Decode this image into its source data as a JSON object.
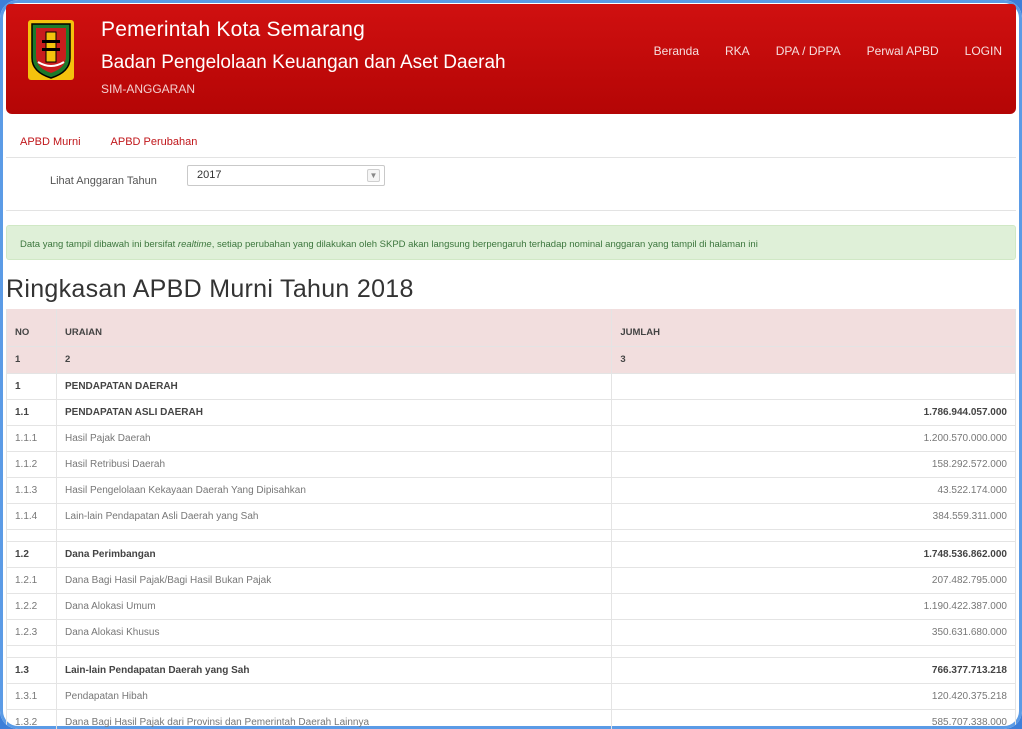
{
  "header": {
    "title": "Pemerintah Kota Semarang",
    "subtitle": "Badan Pengelolaan Keuangan dan Aset Daerah",
    "app": "SIM-ANGGARAN",
    "nav": [
      "Beranda",
      "RKA",
      "DPA / DPPA",
      "Perwal APBD",
      "LOGIN"
    ]
  },
  "subnav": [
    "APBD Murni",
    "APBD Perubahan"
  ],
  "year_filter": {
    "label": "Lihat Anggaran Tahun",
    "value": "2017"
  },
  "alert": {
    "before": "Data yang tampil dibawah ini bersifat ",
    "em": "realtime",
    "after": ", setiap perubahan yang dilakukan oleh SKPD akan langsung berpengaruh terhadap nominal anggaran yang tampil di halaman ini"
  },
  "page_title": "Ringkasan APBD Murni Tahun 2018",
  "table": {
    "headers": [
      "NO",
      "URAIAN",
      "JUMLAH"
    ],
    "index_row": [
      "1",
      "2",
      "3"
    ],
    "rows": [
      {
        "no": "1",
        "uraian": "PENDAPATAN DAERAH",
        "jumlah": "",
        "bold": true
      },
      {
        "no": "1.1",
        "uraian": "PENDAPATAN ASLI DAERAH",
        "jumlah": "1.786.944.057.000",
        "bold": true
      },
      {
        "no": "1.1.1",
        "uraian": "Hasil Pajak Daerah",
        "jumlah": "1.200.570.000.000"
      },
      {
        "no": "1.1.2",
        "uraian": "Hasil Retribusi Daerah",
        "jumlah": "158.292.572.000"
      },
      {
        "no": "1.1.3",
        "uraian": "Hasil Pengelolaan Kekayaan Daerah Yang Dipisahkan",
        "jumlah": "43.522.174.000"
      },
      {
        "no": "1.1.4",
        "uraian": "Lain-lain Pendapatan Asli Daerah yang Sah",
        "jumlah": "384.559.311.000"
      },
      {
        "gap": true
      },
      {
        "no": "1.2",
        "uraian": "Dana Perimbangan",
        "jumlah": "1.748.536.862.000",
        "bold": true
      },
      {
        "no": "1.2.1",
        "uraian": "Dana Bagi Hasil Pajak/Bagi Hasil Bukan Pajak",
        "jumlah": "207.482.795.000"
      },
      {
        "no": "1.2.2",
        "uraian": "Dana Alokasi Umum",
        "jumlah": "1.190.422.387.000"
      },
      {
        "no": "1.2.3",
        "uraian": "Dana Alokasi Khusus",
        "jumlah": "350.631.680.000"
      },
      {
        "gap": true
      },
      {
        "no": "1.3",
        "uraian": "Lain-lain Pendapatan Daerah yang Sah",
        "jumlah": "766.377.713.218",
        "bold": true
      },
      {
        "no": "1.3.1",
        "uraian": "Pendapatan Hibah",
        "jumlah": "120.420.375.218"
      },
      {
        "no": "1.3.2",
        "uraian": "Dana Bagi Hasil Pajak dari Provinsi dan Pemerintah Daerah Lainnya",
        "jumlah": "585.707.338.000"
      }
    ]
  }
}
